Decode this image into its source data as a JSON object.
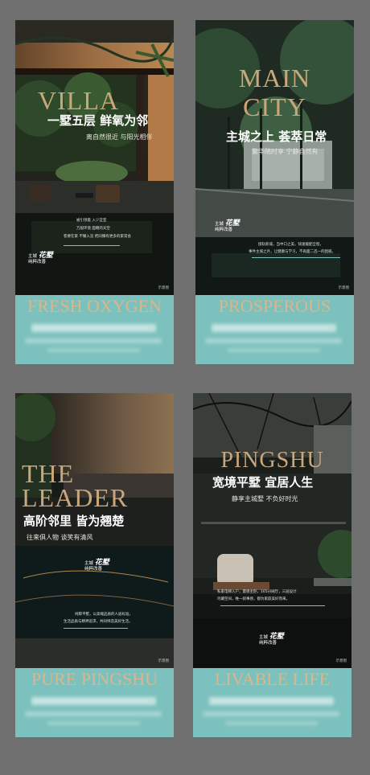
{
  "posters": [
    {
      "headline_en": "VILLA",
      "headline_cn": "一墅五层 鲜氧为邻",
      "subline_cn": "离自然很近 与阳光相伴",
      "band_title": "FRESH OXYGEN",
      "logo_top": "主城",
      "logo_brand": "花墅",
      "logo_bottom": "纯粹改善",
      "corner_text": "示意图",
      "copy_lines": [
        "被引领着 入少宜室",
        "万般环境 面朝的天空",
        "客要在家 不懈入览 把同臻有更多的家常会"
      ]
    },
    {
      "headline_en_1": "MAIN",
      "headline_en_2": "CITY",
      "headline_cn": "主城之上 荟萃日常",
      "subline_cn": "繁华随时享 宁静自然有",
      "band_title": "PROSPEROUS",
      "logo_top": "主城",
      "logo_brand": "花墅",
      "logo_bottom": "纯粹改善",
      "corner_text": "示意图",
      "copy_lines": [
        "接轨新城，当中口之美，快速缓配全程，",
        "事件主城之外，让健康与学习，不再面二选一的困惑。"
      ]
    },
    {
      "headline_en_1": "THE",
      "headline_en_2": "LEADER",
      "headline_cn": "高阶邻里 皆为翘楚",
      "subline_cn": "往来俱人物 谈笑有清风",
      "band_title": "PURE PINGSHU",
      "logo_top": "主城",
      "logo_brand": "花墅",
      "logo_bottom": "纯粹改善",
      "corner_text": "示意图",
      "copy_lines": [
        "纯粹平墅，以高端品质的人居标准，",
        "生活品质与精神追求，共同缔造美好生活。"
      ]
    },
    {
      "headline_en": "PINGSHU",
      "headline_cn": "宽境平墅 宜居人生",
      "subline_cn": "静享主城墅 不负好时光",
      "band_title": "LIVABLE LIFE",
      "logo_top": "主城",
      "logo_brand": "花墅",
      "logo_bottom": "纯粹改善",
      "corner_text": "示意图",
      "copy_lines": [
        "私家电梯入户，量感主卧，165㎡阔厅，三层设计",
        "尽藏空间，唯一叙事感，都为家庭美好而来。"
      ]
    }
  ],
  "colors": {
    "background": "#6f6f6f",
    "band": "#7cc1bd",
    "gold": "#c9a77a",
    "band_text": "#d9b78b"
  }
}
